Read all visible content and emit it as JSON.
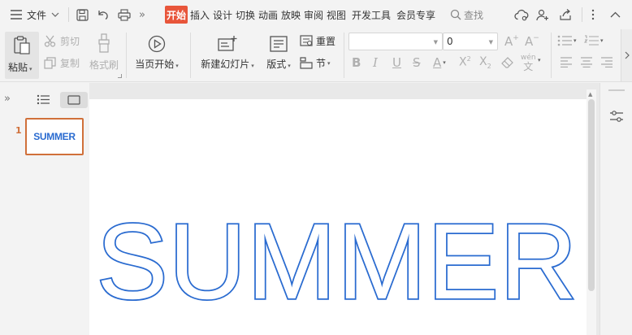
{
  "menu": {
    "file_label": "文件",
    "tabs": [
      {
        "label": "开始",
        "active": true
      },
      {
        "label": "插入",
        "active": false
      },
      {
        "label": "设计",
        "active": false
      },
      {
        "label": "切换",
        "active": false
      },
      {
        "label": "动画",
        "active": false
      },
      {
        "label": "放映",
        "active": false
      },
      {
        "label": "审阅",
        "active": false
      },
      {
        "label": "视图",
        "active": false
      },
      {
        "label": "开发工具",
        "active": false
      },
      {
        "label": "会员专享",
        "active": false
      }
    ],
    "search_label": "查找"
  },
  "ribbon": {
    "paste": "粘贴",
    "cut": "剪切",
    "copy": "复制",
    "format_painter": "格式刷",
    "play_from_current": "当页开始",
    "new_slide": "新建幻灯片",
    "layout": "版式",
    "reset": "重置",
    "section": "节",
    "font_name": "",
    "font_size": "0",
    "pinyin": "wén"
  },
  "slides": [
    {
      "number": "1",
      "thumb_text": "SUMMER"
    }
  ],
  "slide": {
    "title": "SUMMER"
  },
  "colors": {
    "accent": "#e8553a",
    "text_outline": "#2a6bd0",
    "thumb_border": "#d0703a"
  }
}
